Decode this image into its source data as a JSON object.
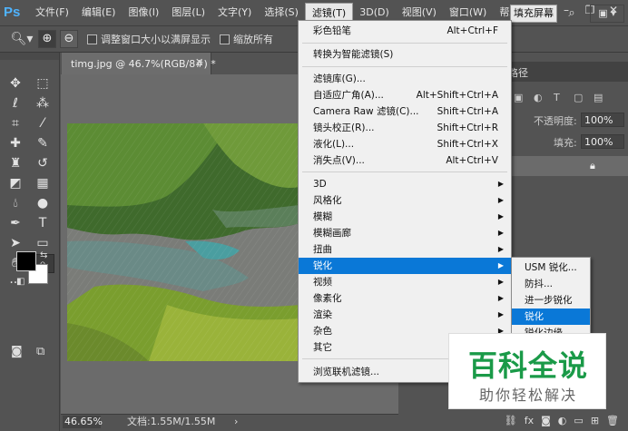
{
  "app": {
    "logo": "Ps"
  },
  "menubar": {
    "items": [
      "文件(F)",
      "编辑(E)",
      "图像(I)",
      "图层(L)",
      "文字(Y)",
      "选择(S)",
      "滤镜(T)",
      "3D(D)",
      "视图(V)",
      "窗口(W)",
      "帮助(H)"
    ],
    "active_index": 6
  },
  "options_bar": {
    "checkbox1_label": "调整窗口大小以满屏显示",
    "checkbox2_label": "缩放所有",
    "fill_screen_label": "填充屏幕"
  },
  "document": {
    "tab_title": "timg.jpg @ 46.7%(RGB/8#) *",
    "zoom": "46.65%",
    "doc_info": "文档:1.55M/1.55M"
  },
  "right_panel": {
    "tab_label": "路径",
    "opacity_label": "不透明度:",
    "opacity_value": "100%",
    "fill_label": "填充:",
    "fill_value": "100%"
  },
  "filter_menu": {
    "items": [
      {
        "label": "彩色铅笔",
        "shortcut": "Alt+Ctrl+F"
      },
      {
        "label": "转换为智能滤镜(S)",
        "shortcut": ""
      },
      {
        "label": "滤镜库(G)...",
        "shortcut": ""
      },
      {
        "label": "自适应广角(A)...",
        "shortcut": "Alt+Shift+Ctrl+A"
      },
      {
        "label": "Camera Raw 滤镜(C)...",
        "shortcut": "Shift+Ctrl+A"
      },
      {
        "label": "镜头校正(R)...",
        "shortcut": "Shift+Ctrl+R"
      },
      {
        "label": "液化(L)...",
        "shortcut": "Shift+Ctrl+X"
      },
      {
        "label": "消失点(V)...",
        "shortcut": "Alt+Ctrl+V"
      },
      {
        "label": "3D",
        "shortcut": ""
      },
      {
        "label": "风格化",
        "shortcut": ""
      },
      {
        "label": "模糊",
        "shortcut": ""
      },
      {
        "label": "模糊画廊",
        "shortcut": ""
      },
      {
        "label": "扭曲",
        "shortcut": ""
      },
      {
        "label": "锐化",
        "shortcut": ""
      },
      {
        "label": "视频",
        "shortcut": ""
      },
      {
        "label": "像素化",
        "shortcut": ""
      },
      {
        "label": "渲染",
        "shortcut": ""
      },
      {
        "label": "杂色",
        "shortcut": ""
      },
      {
        "label": "其它",
        "shortcut": ""
      },
      {
        "label": "浏览联机滤镜...",
        "shortcut": ""
      }
    ],
    "highlighted": "锐化"
  },
  "sharpen_submenu": {
    "items": [
      "USM 锐化...",
      "防抖...",
      "进一步锐化",
      "锐化",
      "锐化边缘"
    ],
    "highlighted": "锐化"
  },
  "watermark": {
    "title": "百科全说",
    "subtitle": "助你轻松解决"
  },
  "colors": {
    "menu_highlight": "#0a78d7",
    "watermark_green": "#1a9a48",
    "ui_dark": "#535353"
  }
}
